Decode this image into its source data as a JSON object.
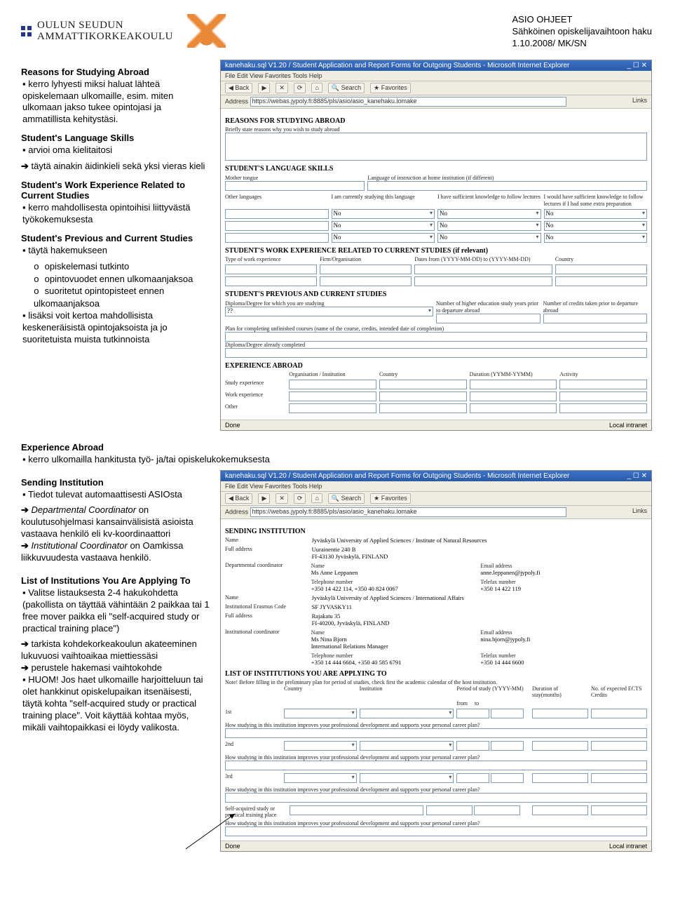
{
  "header": {
    "logo_line1": "OULUN SEUDUN",
    "logo_line2": "AMMATTIKORKEAKOULU",
    "right_line1": "ASIO OHJEET",
    "right_line2": "Sähköinen opiskelijavaihtoon haku",
    "right_line3": "1.10.2008/ MK/SN"
  },
  "sections": {
    "reasons": {
      "title": "Reasons for Studying Abroad",
      "b1": "kerro lyhyesti miksi haluat lähteä opiskelemaan ulkomaille, esim. miten ulkomaan jakso tukee opintojasi ja ammatillista kehitystäsi."
    },
    "lang": {
      "title": "Student's Language Skills",
      "b1": "arvioi oma kielitaitosi",
      "a1": "täytä ainakin äidinkieli sekä yksi vieras kieli"
    },
    "work": {
      "title": "Student's Work Experience Related to Current Studies",
      "b1": "kerro mahdollisesta opintoihisi liittyvästä työkokemuksesta"
    },
    "prev": {
      "title": "Student's Previous and Current Studies",
      "b1": "täytä hakemukseen",
      "s1": "opiskelemasi tutkinto",
      "s2": "opintovuodet ennen ulkomaanjaksoa",
      "s3": "suoritetut opintopisteet ennen ulkomaanjaksoa",
      "b2": "lisäksi voit kertoa mahdollisista keskeneräisistä opintojaksoista ja jo suoritetuista muista tutkinnoista"
    },
    "exp": {
      "title": "Experience Abroad",
      "b1": "kerro ulkomailla hankitusta työ- ja/tai opiskelukokemuksesta"
    },
    "send": {
      "title": "Sending Institution",
      "b1": "Tiedot tulevat automaattisesti ASIOsta",
      "a1a": "Departmental Coordinator",
      "a1b": " on koulutusohjelmasi kansainvälisistä asioista vastaava henkilö eli kv-koordinaattori",
      "a2a": "Institutional Coordinator",
      "a2b": " on Oamkissa liikkuvuudesta vastaava henkilö."
    },
    "list": {
      "title": "List of Institutions You Are Applying To",
      "b1": "Valitse listauksesta 2-4 hakukohdetta (pakollista on täyttää vähintään 2 paikkaa tai 1 free mover paikka eli \"self-acquired study or practical training place\")",
      "a1": "tarkista kohdekorkeakoulun akateeminen lukuvuosi vaihtoaikaa miettiessäsi",
      "a2": "perustele hakemasi vaihtokohde",
      "b2_pre": "HUOM! Jos haet ulkomaille harjoitteluun tai olet hankkinut opiskelupaikan itsenäisesti, täytä kohta \"self-acquired study or practical training place\". Voit käyttää kohtaa myös, mikäli vaihtopaikkasi ei löydy valikosta."
    }
  },
  "browser1": {
    "title": "kanehaku.sql V1.20 / Student Application and Report Forms for Outgoing Students - Microsoft Internet Explorer",
    "menu": "File   Edit   View   Favorites   Tools   Help",
    "back": "Back",
    "search": "Search",
    "fav": "Favorites",
    "addr_label": "Address",
    "addr": "https://webas.jypoly.fi:8885/pls/asio/asio_kanehaku.lomake",
    "links": "Links",
    "h_reasons": "REASONS FOR STUDYING ABROAD",
    "h_reasons_sub": "Briefly state reasons why you wish to study abroad",
    "h_lang": "STUDENT'S LANGUAGE SKILLS",
    "lang_mt": "Mother tongue",
    "lang_inst": "Language of instruction at home institution (if different)",
    "lang_other": "Other languages",
    "lang_c1": "I am currently studying this language",
    "lang_c2": "I have sufficient knowledge to follow lectures",
    "lang_c3": "I would have sufficient knowledge to follow lectures if I had some extra preparation",
    "no": "No",
    "h_work": "STUDENT'S WORK EXPERIENCE RELATED TO CURRENT STUDIES  (if relevant)",
    "w_type": "Type of work experience",
    "w_firm": "Firm/Organisation",
    "w_dates": "Dates from (YYYY-MM-DD)  to  (YYYY-MM-DD)",
    "w_country": "Country",
    "h_prev": "STUDENT'S PREVIOUS AND CURRENT STUDIES",
    "p_deg": "Diploma/Degree for which you are studying",
    "p_num_he": "Number of higher education study years prior to departure abroad",
    "p_num_cr": "Number of credits taken prior to departure abroad",
    "p_plan": "Plan for completing unfinished courses (name of the course, credits, intended date of completion)",
    "p_compl": "Diploma/Degree already completed",
    "h_exp": "EXPERIENCE ABROAD",
    "e_org": "Organisation / Institution",
    "e_country": "Country",
    "e_dur": "Duration (YYMM-YYMM)",
    "e_act": "Activity",
    "e_study": "Study experience",
    "e_work": "Work experience",
    "e_other": "Other",
    "done": "Done",
    "intranet": "Local intranet"
  },
  "browser2": {
    "h_send": "SENDING INSTITUTION",
    "s_name": "Name",
    "s_name_v": "Jyväskylä University of Applied Sciences / Institute of Natural Resources",
    "s_addr": "Full address",
    "s_addr_v": "Uurainentie 240 B\nFI-43130 Jyväskylä, FINLAND",
    "s_dept": "Departmental coordinator",
    "s_dc_name": "Ms Anne Leppanen",
    "s_email": "Email address",
    "s_email_v": "anne.leppanen@jypoly.fi",
    "s_tel": "Telephone number",
    "s_tel_v": "+350 14 422 114, +350 40 824 0067",
    "s_fax": "Telefax number",
    "s_fax_v": "+350 14 422 119",
    "s_inst_name": "Jyväskylä University of Applied Sciences / International Affairs",
    "s_er": "Institutional Erasmus Code",
    "s_er_v": "SF JYVASKY11",
    "s_addr2": "Rajakatu 35\nFI-40200, Jyväskylä, FINLAND",
    "s_ic": "Institutional coordinator",
    "s_ic_name": "Ms Nina Bjorn",
    "s_ic_title": "International Relations Manager",
    "s_ic_email": "nina.bjorn@jypoly.fi",
    "s_ic_tel": "+350 14 444 6604, +350 40 585 6791",
    "s_ic_fax": "+350 14 444 6600",
    "h_list": "LIST OF INSTITUTIONS YOU ARE APPLYING TO",
    "list_note": "Note! Before filling in the preliminary plan for period of studies, check first the academic calendar of the host institution.",
    "l_country": "Country",
    "l_inst": "Institution",
    "l_period": "Period of study (YYYY-MM)",
    "l_from": "from",
    "l_to": "to",
    "l_dur": "Duration of stay(months)",
    "l_ects": "No. of expected ECTS Credits",
    "l_1": "1st",
    "l_2": "2nd",
    "l_3": "3rd",
    "l_q": "How studying in this institution improves your professional development and supports your personal career plan?",
    "l_self": "Self-acquired study or practical training place"
  }
}
